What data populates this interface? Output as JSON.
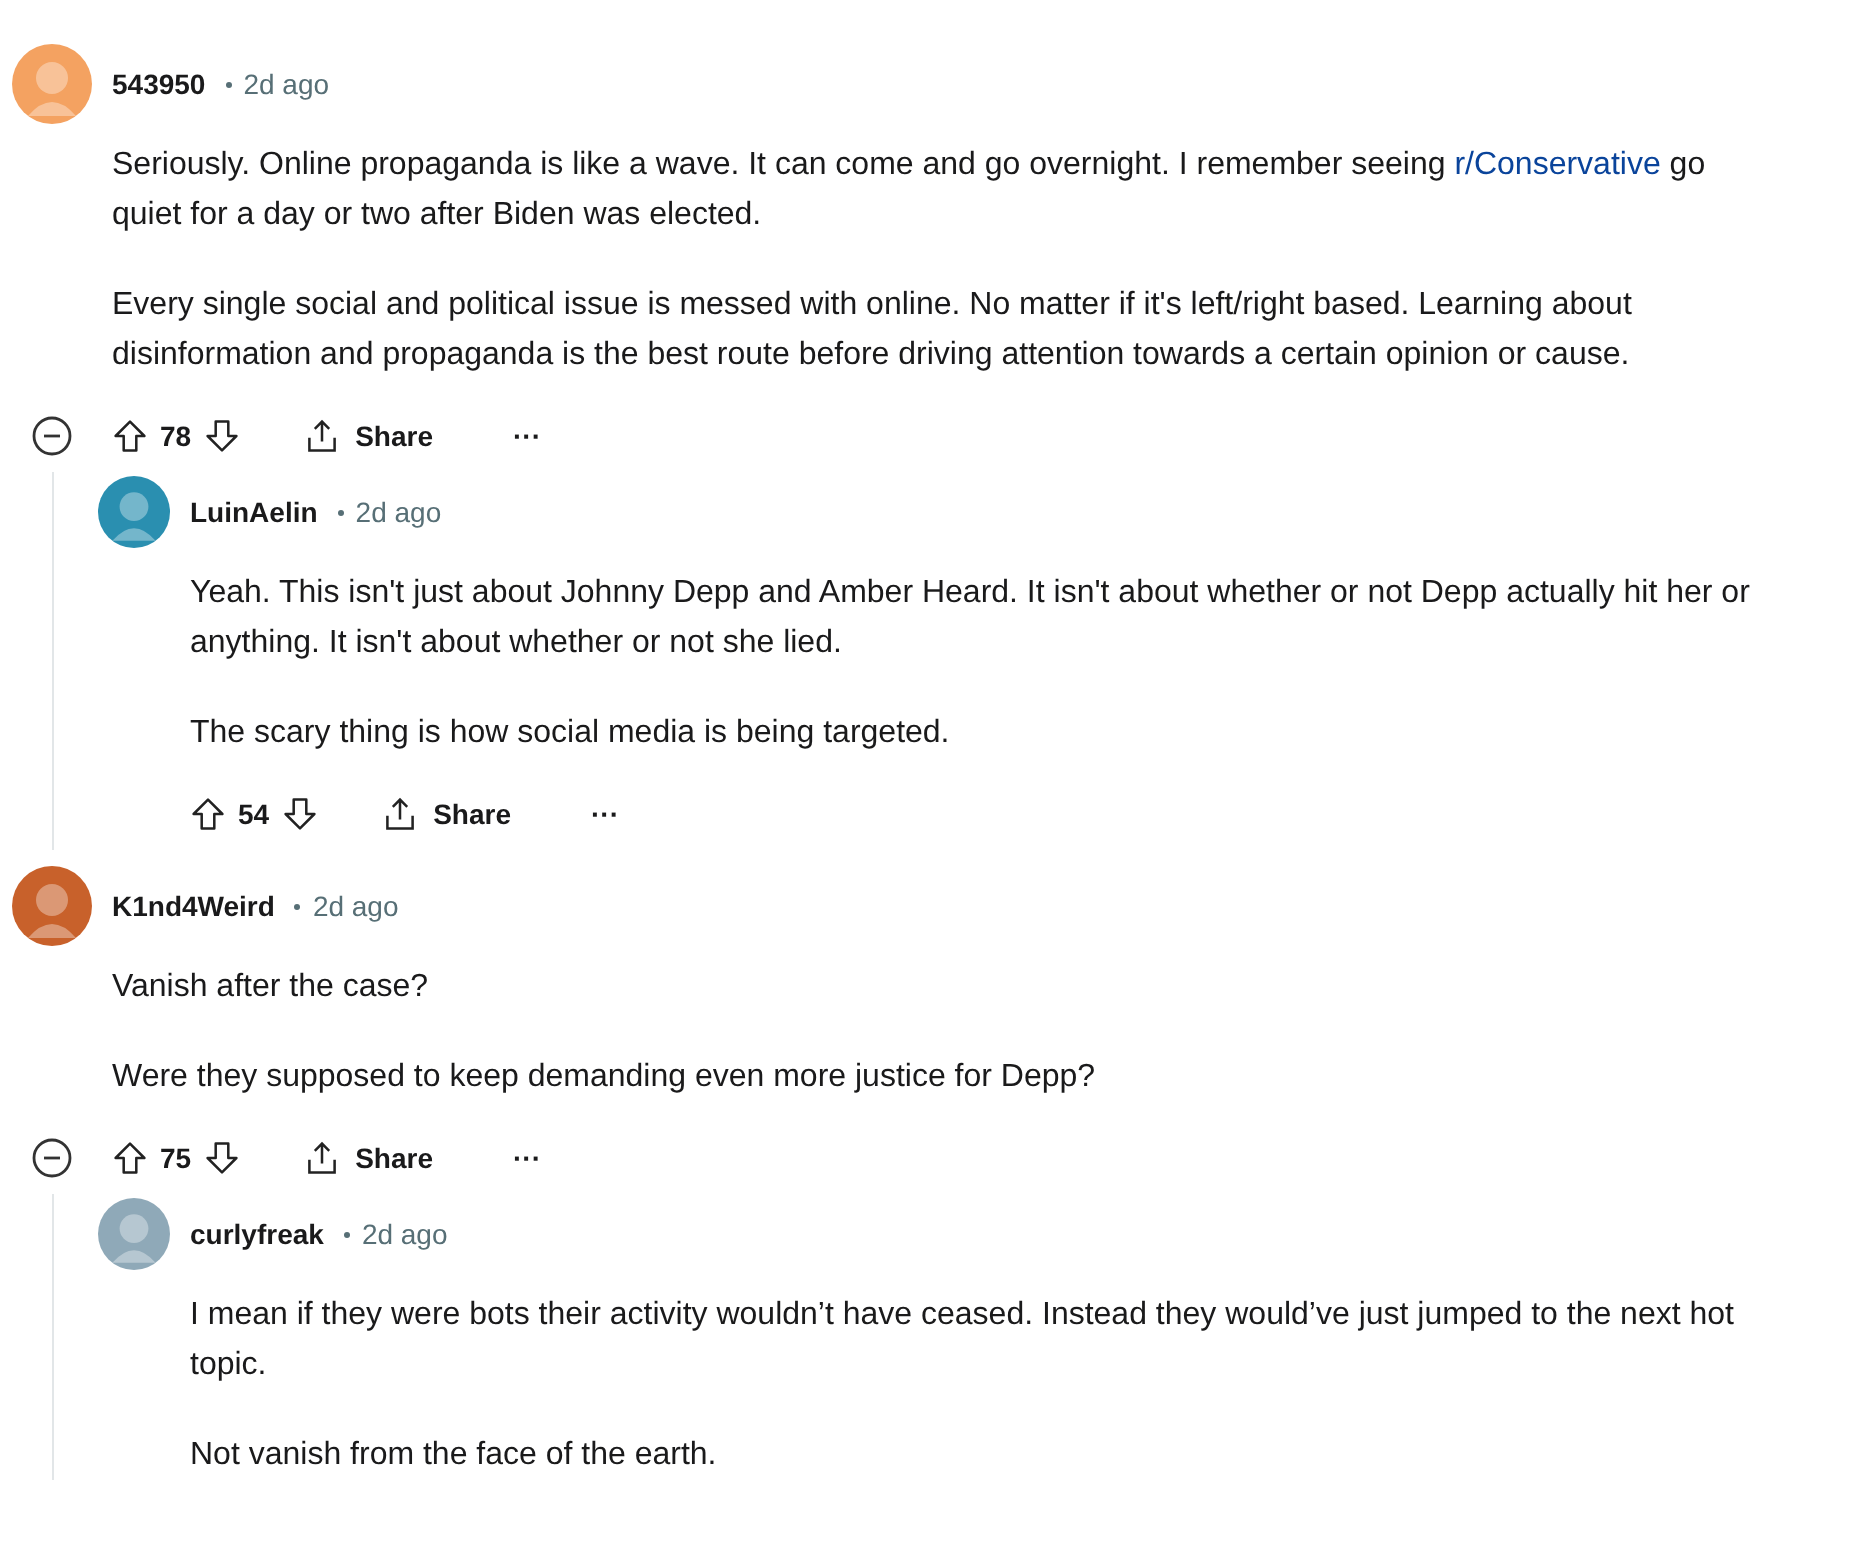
{
  "comments": [
    {
      "author": "543950",
      "time": "2d ago",
      "color": "#f4a261",
      "paragraphs": [
        [
          {
            "kind": "text",
            "text": "Seriously. Online propaganda is like a wave. It can come and go overnight. I remember seeing "
          },
          {
            "kind": "link",
            "text": "r/Conservative"
          },
          {
            "kind": "text",
            "text": " go quiet for a day or two after Biden was elected."
          }
        ],
        [
          {
            "kind": "text",
            "text": "Every single social and political issue is messed with online. No matter if it's left/right based. Learning about disinformation and propaganda is the best route before driving attention towards a certain opinion or cause."
          }
        ]
      ],
      "votes": "78",
      "share": "Share",
      "more": "···",
      "expanded": true,
      "children": [
        {
          "author": "LuinAelin",
          "time": "2d ago",
          "color": "#2a8fb0",
          "paragraphs": [
            [
              {
                "kind": "text",
                "text": "Yeah. This isn't just about Johnny Depp and Amber Heard. It isn't about whether or not Depp actually hit her or anything. It isn't about whether or not she lied."
              }
            ],
            [
              {
                "kind": "text",
                "text": "The scary thing is how social media is being targeted."
              }
            ]
          ],
          "votes": "54",
          "share": "Share",
          "more": "···"
        }
      ]
    },
    {
      "author": "K1nd4Weird",
      "time": "2d ago",
      "color": "#c8612b",
      "paragraphs": [
        [
          {
            "kind": "text",
            "text": "Vanish after the case?"
          }
        ],
        [
          {
            "kind": "text",
            "text": "Were they supposed to keep demanding even more justice for Depp?"
          }
        ]
      ],
      "votes": "75",
      "share": "Share",
      "more": "···",
      "expanded": true,
      "children": [
        {
          "author": "curlyfreak",
          "time": "2d ago",
          "color": "#8fa9b8",
          "paragraphs": [
            [
              {
                "kind": "text",
                "text": "I mean if they were bots their activity wouldn’t have ceased. Instead they would’ve just jumped to the next hot topic."
              }
            ],
            [
              {
                "kind": "text",
                "text": "Not vanish from the face of the earth."
              }
            ]
          ]
        }
      ]
    }
  ]
}
